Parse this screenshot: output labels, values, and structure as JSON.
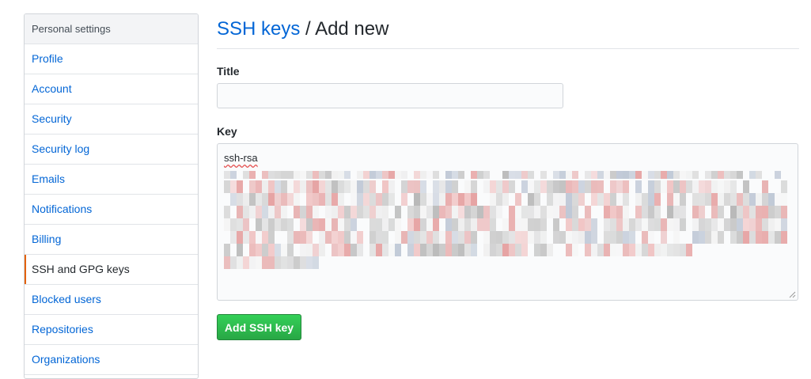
{
  "sidebar": {
    "header": "Personal settings",
    "items": [
      {
        "label": "Profile",
        "name": "profile"
      },
      {
        "label": "Account",
        "name": "account"
      },
      {
        "label": "Security",
        "name": "security"
      },
      {
        "label": "Security log",
        "name": "security-log"
      },
      {
        "label": "Emails",
        "name": "emails"
      },
      {
        "label": "Notifications",
        "name": "notifications"
      },
      {
        "label": "Billing",
        "name": "billing"
      },
      {
        "label": "SSH and GPG keys",
        "name": "ssh-and-gpg-keys",
        "selected": true
      },
      {
        "label": "Blocked users",
        "name": "blocked-users"
      },
      {
        "label": "Repositories",
        "name": "repositories"
      },
      {
        "label": "Organizations",
        "name": "organizations"
      }
    ]
  },
  "page": {
    "breadcrumb_link": "SSH keys",
    "separator": " / ",
    "title": "Add new"
  },
  "form": {
    "title_label": "Title",
    "title_value": "",
    "key_label": "Key",
    "key_prefix": "ssh-rsa",
    "submit_label": "Add SSH key"
  },
  "colors": {
    "link": "#0366d6",
    "selected_indicator": "#e36209",
    "button": "#28a745"
  }
}
